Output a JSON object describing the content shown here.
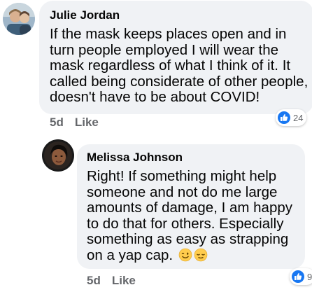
{
  "comments": [
    {
      "author": "Julie Jordan",
      "text": "If the mask keeps places open and in turn people employed I will wear the mask regardless of what I think of it. It called being considerate of other people, doesn't have to be about COVID!",
      "time": "5d",
      "like_label": "Like",
      "reaction_count": "24",
      "reaction_icon": "like-thumbs-up-icon"
    },
    {
      "author": "Melissa Johnson",
      "text": "Right! If something might help someone and not do me large amounts of damage, I am happy to do that for others. Especially something as easy as strapping on a yap cap.",
      "time": "5d",
      "like_label": "Like",
      "reaction_count": "9",
      "reaction_icon": "like-thumbs-up-icon",
      "emoji": [
        "winking-face-emoji",
        "relieved-face-emoji"
      ]
    }
  ],
  "colors": {
    "bubble": "#f0f2f5",
    "like_blue": "#1877f2",
    "meta_gray": "#65676b"
  }
}
